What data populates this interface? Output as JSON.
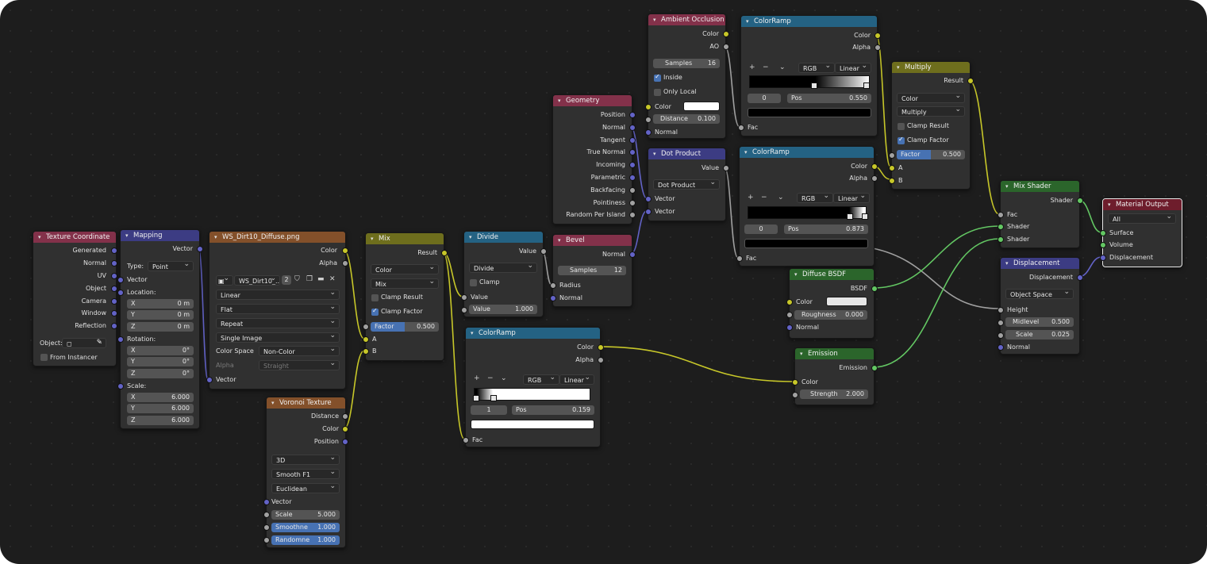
{
  "colors": {
    "input": "#83314a",
    "vector": "#3c3c83",
    "texture": "#83502a",
    "color": "#6e6e1d",
    "converter": "#246283",
    "shader": "#2b652b",
    "output": "#6e1d2c"
  },
  "tex_coord": {
    "title": "Texture Coordinate",
    "outputs": [
      "Generated",
      "Normal",
      "UV",
      "Object",
      "Camera",
      "Window",
      "Reflection"
    ],
    "object_label": "Object:",
    "from_instancer": "From Instancer"
  },
  "mapping": {
    "title": "Mapping",
    "output": "Vector",
    "type_label": "Type:",
    "type_value": "Point",
    "vector": "Vector",
    "location": "Location:",
    "loc": [
      {
        "a": "X",
        "v": "0 m"
      },
      {
        "a": "Y",
        "v": "0 m"
      },
      {
        "a": "Z",
        "v": "0 m"
      }
    ],
    "rotation": "Rotation:",
    "rot": [
      {
        "a": "X",
        "v": "0°"
      },
      {
        "a": "Y",
        "v": "0°"
      },
      {
        "a": "Z",
        "v": "0°"
      }
    ],
    "scale": "Scale:",
    "scl": [
      {
        "a": "X",
        "v": "6.000"
      },
      {
        "a": "Y",
        "v": "6.000"
      },
      {
        "a": "Z",
        "v": "6.000"
      }
    ]
  },
  "image_tex": {
    "title": "WS_Dirt10_Diffuse.png",
    "out_color": "Color",
    "out_alpha": "Alpha",
    "image_name": "WS_Dirt10_...",
    "users": "2",
    "interp": "Linear",
    "projection": "Flat",
    "extension": "Repeat",
    "source": "Single Image",
    "colorspace_label": "Color Space",
    "colorspace_value": "Non-Color",
    "alpha_label": "Alpha",
    "alpha_value": "Straight",
    "in_vector": "Vector"
  },
  "voronoi": {
    "title": "Voronoi Texture",
    "outputs": [
      "Distance",
      "Color",
      "Position"
    ],
    "dim": "3D",
    "feature": "Smooth F1",
    "metric": "Euclidean",
    "in_vector": "Vector",
    "scale_label": "Scale",
    "scale_value": "5.000",
    "smooth_label": "Smoothne",
    "smooth_value": "1.000",
    "random_label": "Randomne",
    "random_value": "1.000"
  },
  "mix": {
    "title": "Mix",
    "output": "Result",
    "dtype": "Color",
    "blend": "Mix",
    "clamp_result": "Clamp Result",
    "clamp_factor": "Clamp Factor",
    "factor_label": "Factor",
    "factor_value": "0.500",
    "in_a": "A",
    "in_b": "B"
  },
  "divide": {
    "title": "Divide",
    "output": "Value",
    "op": "Divide",
    "clamp": "Clamp",
    "in_value": "Value",
    "value_label": "Value",
    "value_value": "1.000"
  },
  "bevel": {
    "title": "Bevel",
    "output": "Normal",
    "samples_label": "Samples",
    "samples_value": "12",
    "in_radius": "Radius",
    "in_normal": "Normal"
  },
  "ramp3": {
    "title": "ColorRamp",
    "out_color": "Color",
    "out_alpha": "Alpha",
    "mode": "RGB",
    "interp": "Linear",
    "index": "1",
    "pos_label": "Pos",
    "pos_value": "0.159",
    "in_fac": "Fac"
  },
  "geometry": {
    "title": "Geometry",
    "outputs": [
      "Position",
      "Normal",
      "Tangent",
      "True Normal",
      "Incoming",
      "Parametric",
      "Backfacing",
      "Pointiness",
      "Random Per Island"
    ]
  },
  "ao": {
    "title": "Ambient Occlusion",
    "out_color": "Color",
    "out_ao": "AO",
    "samples_label": "Samples",
    "samples_value": "16",
    "inside": "Inside",
    "only_local": "Only Local",
    "in_color": "Color",
    "distance_label": "Distance",
    "distance_value": "0.100",
    "in_normal": "Normal"
  },
  "dot": {
    "title": "Dot Product",
    "output": "Value",
    "op": "Dot Product",
    "in1": "Vector",
    "in2": "Vector"
  },
  "ramp1": {
    "title": "ColorRamp",
    "out_color": "Color",
    "out_alpha": "Alpha",
    "mode": "RGB",
    "interp": "Linear",
    "index": "0",
    "pos_label": "Pos",
    "pos_value": "0.550",
    "in_fac": "Fac"
  },
  "ramp2": {
    "title": "ColorRamp",
    "out_color": "Color",
    "out_alpha": "Alpha",
    "mode": "RGB",
    "interp": "Linear",
    "index": "0",
    "pos_label": "Pos",
    "pos_value": "0.873",
    "in_fac": "Fac"
  },
  "multiply": {
    "title": "Multiply",
    "output": "Result",
    "dtype": "Color",
    "blend": "Multiply",
    "clamp_result": "Clamp Result",
    "clamp_factor": "Clamp Factor",
    "factor_label": "Factor",
    "factor_value": "0.500",
    "in_a": "A",
    "in_b": "B"
  },
  "diffuse": {
    "title": "Diffuse BSDF",
    "output": "BSDF",
    "in_color": "Color",
    "rough_label": "Roughness",
    "rough_value": "0.000",
    "in_normal": "Normal"
  },
  "emission": {
    "title": "Emission",
    "output": "Emission",
    "in_color": "Color",
    "strength_label": "Strength",
    "strength_value": "2.000"
  },
  "mix_shader": {
    "title": "Mix Shader",
    "output": "Shader",
    "in_fac": "Fac",
    "in_s1": "Shader",
    "in_s2": "Shader"
  },
  "displacement": {
    "title": "Displacement",
    "output": "Displacement",
    "space": "Object Space",
    "in_height": "Height",
    "mid_label": "Midlevel",
    "mid_value": "0.500",
    "scale_label": "Scale",
    "scale_value": "0.025",
    "in_normal": "Normal"
  },
  "mat_out": {
    "title": "Material Output",
    "target": "All",
    "in_surface": "Surface",
    "in_volume": "Volume",
    "in_disp": "Displacement"
  }
}
